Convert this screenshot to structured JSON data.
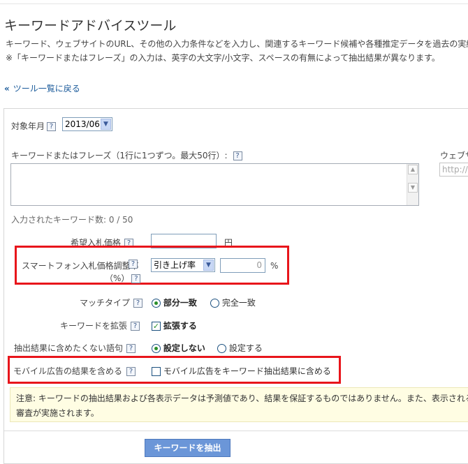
{
  "page": {
    "title": "キーワードアドバイスツール",
    "desc1": "キーワード、ウェブサイトのURL、その他の入力条件などを入力し、関連するキーワード候補や各種推定データを過去の実績",
    "desc2": "※「キーワードまたはフレーズ」の入力は、英字の大文字/小文字、スペースの有無によって抽出結果が異なります。",
    "back_chevron": "«",
    "back_link": "ツール一覧に戻る"
  },
  "form": {
    "month_label": "対象年月",
    "month_value": "2013/06",
    "keywords_label": "キーワードまたはフレーズ（1行に1つずつ。最大50行）:",
    "website_label": "ウェブサ",
    "url_placeholder": "http://",
    "keyword_count": "入力されたキーワード数: 0 / 50",
    "bid_label": "希望入札価格",
    "bid_unit": "円",
    "smartphone_label_line1": "スマートフォン入札価格調整率",
    "smartphone_label_line2": "（%）",
    "adjust_select": "引き上げ率",
    "adjust_value": "0",
    "adjust_unit": "%",
    "match_label": "マッチタイプ",
    "match_option1": "部分一致",
    "match_option2": "完全一致",
    "expand_label": "キーワードを拡張",
    "expand_option": "拡張する",
    "exclude_label": "抽出結果に含めたくない語句",
    "exclude_option1": "設定しない",
    "exclude_option2": "設定する",
    "mobile_label": "モバイル広告の結果を含める",
    "mobile_option": "モバイル広告をキーワード抽出結果に含める",
    "help_glyph": "?",
    "check_glyph": "✓"
  },
  "notice": {
    "line1": "注意: キーワードの抽出結果および各表示データは予測値であり、結果を保証するものではありません。また、表示される",
    "line2": "審査が実施されます。"
  },
  "submit_label": "キーワードを抽出",
  "colors": {
    "highlight": "#e8151b",
    "link": "#1a5a9a",
    "notice_bg": "#fffde3",
    "button": "#6b96d8"
  }
}
